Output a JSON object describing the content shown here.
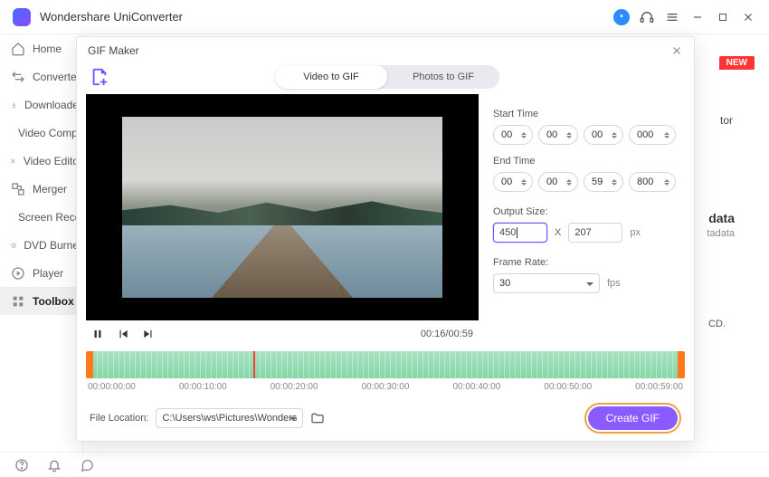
{
  "app": {
    "title": "Wondershare UniConverter"
  },
  "titlebar_icons": [
    "avatar",
    "headset",
    "menu",
    "minimize",
    "maximize",
    "close"
  ],
  "sidebar": {
    "items": [
      {
        "label": "Home"
      },
      {
        "label": "Converter"
      },
      {
        "label": "Downloader"
      },
      {
        "label": "Video Compressor"
      },
      {
        "label": "Video Editor"
      },
      {
        "label": "Merger"
      },
      {
        "label": "Screen Recorder"
      },
      {
        "label": "DVD Burner"
      },
      {
        "label": "Player"
      },
      {
        "label": "Toolbox"
      }
    ],
    "active_index": 9
  },
  "background": {
    "new_badge": "NEW",
    "tor_suffix": "tor",
    "metadata_header": "data",
    "metadata_sub": "tadata",
    "cd_line": "CD."
  },
  "modal": {
    "title": "GIF Maker",
    "tabs": {
      "video": "Video to GIF",
      "photos": "Photos to GIF",
      "active": "video"
    },
    "time_display": "00:16/00:59",
    "start": {
      "label": "Start Time",
      "hh": "00",
      "mm": "00",
      "ss": "00",
      "ms": "000"
    },
    "end": {
      "label": "End Time",
      "hh": "00",
      "mm": "00",
      "ss": "59",
      "ms": "800"
    },
    "output_size": {
      "label": "Output Size:",
      "w": "450",
      "h": "207",
      "sep": "X",
      "unit": "px"
    },
    "frame_rate": {
      "label": "Frame Rate:",
      "value": "30",
      "unit": "fps"
    },
    "ruler": [
      "00:00:00:00",
      "00:00:10:00",
      "00:00:20:00",
      "00:00:30:00",
      "00:00:40:00",
      "00:00:50:00",
      "00:00:59:00"
    ],
    "file_location": {
      "label": "File Location:",
      "path": "C:\\Users\\ws\\Pictures\\Wonders"
    },
    "create_label": "Create GIF",
    "playhead_pct": 28
  }
}
